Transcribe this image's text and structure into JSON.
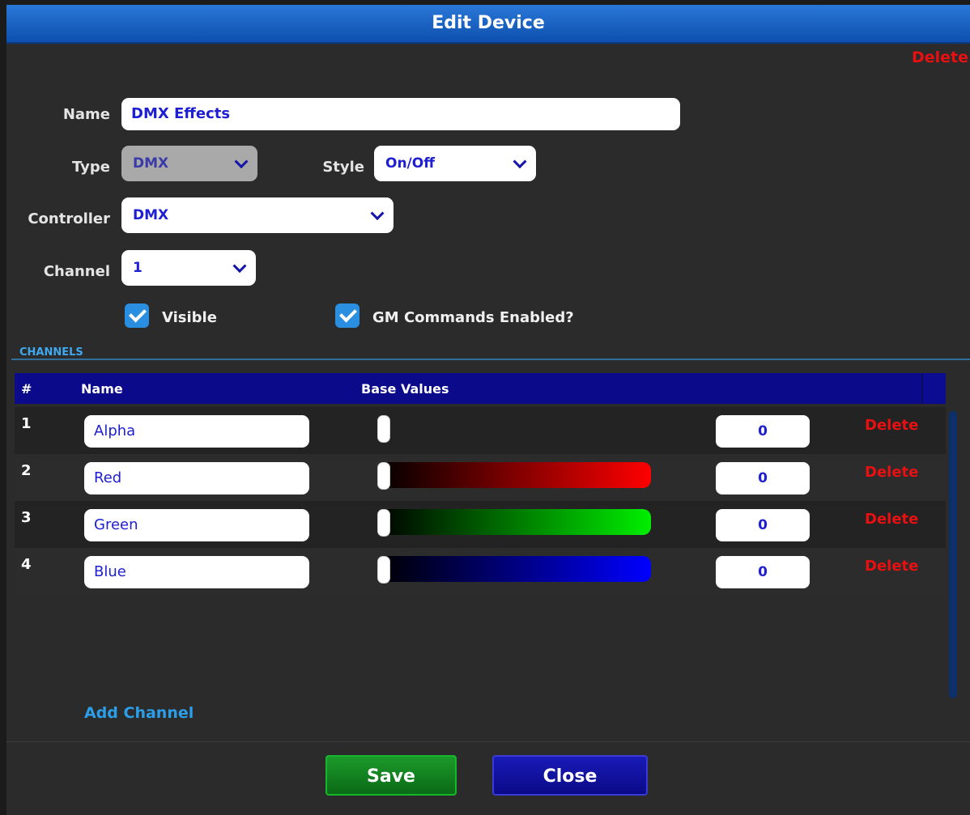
{
  "dialog": {
    "title": "Edit Device",
    "delete_label": "Delete"
  },
  "form": {
    "name": {
      "label": "Name",
      "value": "DMX Effects"
    },
    "type": {
      "label": "Type",
      "value": "DMX",
      "disabled": true
    },
    "style": {
      "label": "Style",
      "value": "On/Off"
    },
    "controller": {
      "label": "Controller",
      "value": "DMX"
    },
    "channel": {
      "label": "Channel",
      "value": "1"
    },
    "visible": {
      "label": "Visible",
      "checked": true
    },
    "gm_commands": {
      "label": "GM Commands Enabled?",
      "checked": true
    }
  },
  "channels": {
    "section_label": "CHANNELS",
    "headers": {
      "num": "#",
      "name": "Name",
      "base_values": "Base Values"
    },
    "rows": [
      {
        "num": "1",
        "name": "Alpha",
        "value": "0",
        "delete": "Delete",
        "slider_level": 0,
        "color": ""
      },
      {
        "num": "2",
        "name": "Red",
        "value": "0",
        "delete": "Delete",
        "slider_level": 0,
        "color": "#ff0000"
      },
      {
        "num": "3",
        "name": "Green",
        "value": "0",
        "delete": "Delete",
        "slider_level": 0,
        "color": "#00ee00"
      },
      {
        "num": "4",
        "name": "Blue",
        "value": "0",
        "delete": "Delete",
        "slider_level": 0,
        "color": "#0000ff"
      }
    ],
    "add_channel_label": "Add Channel"
  },
  "footer": {
    "save_label": "Save",
    "close_label": "Close"
  },
  "colors": {
    "accent": "#1e1ed2",
    "delete": "#e81010",
    "link": "#2c9ee8",
    "save": "#0b7a1a",
    "close": "#0a0a9a"
  }
}
